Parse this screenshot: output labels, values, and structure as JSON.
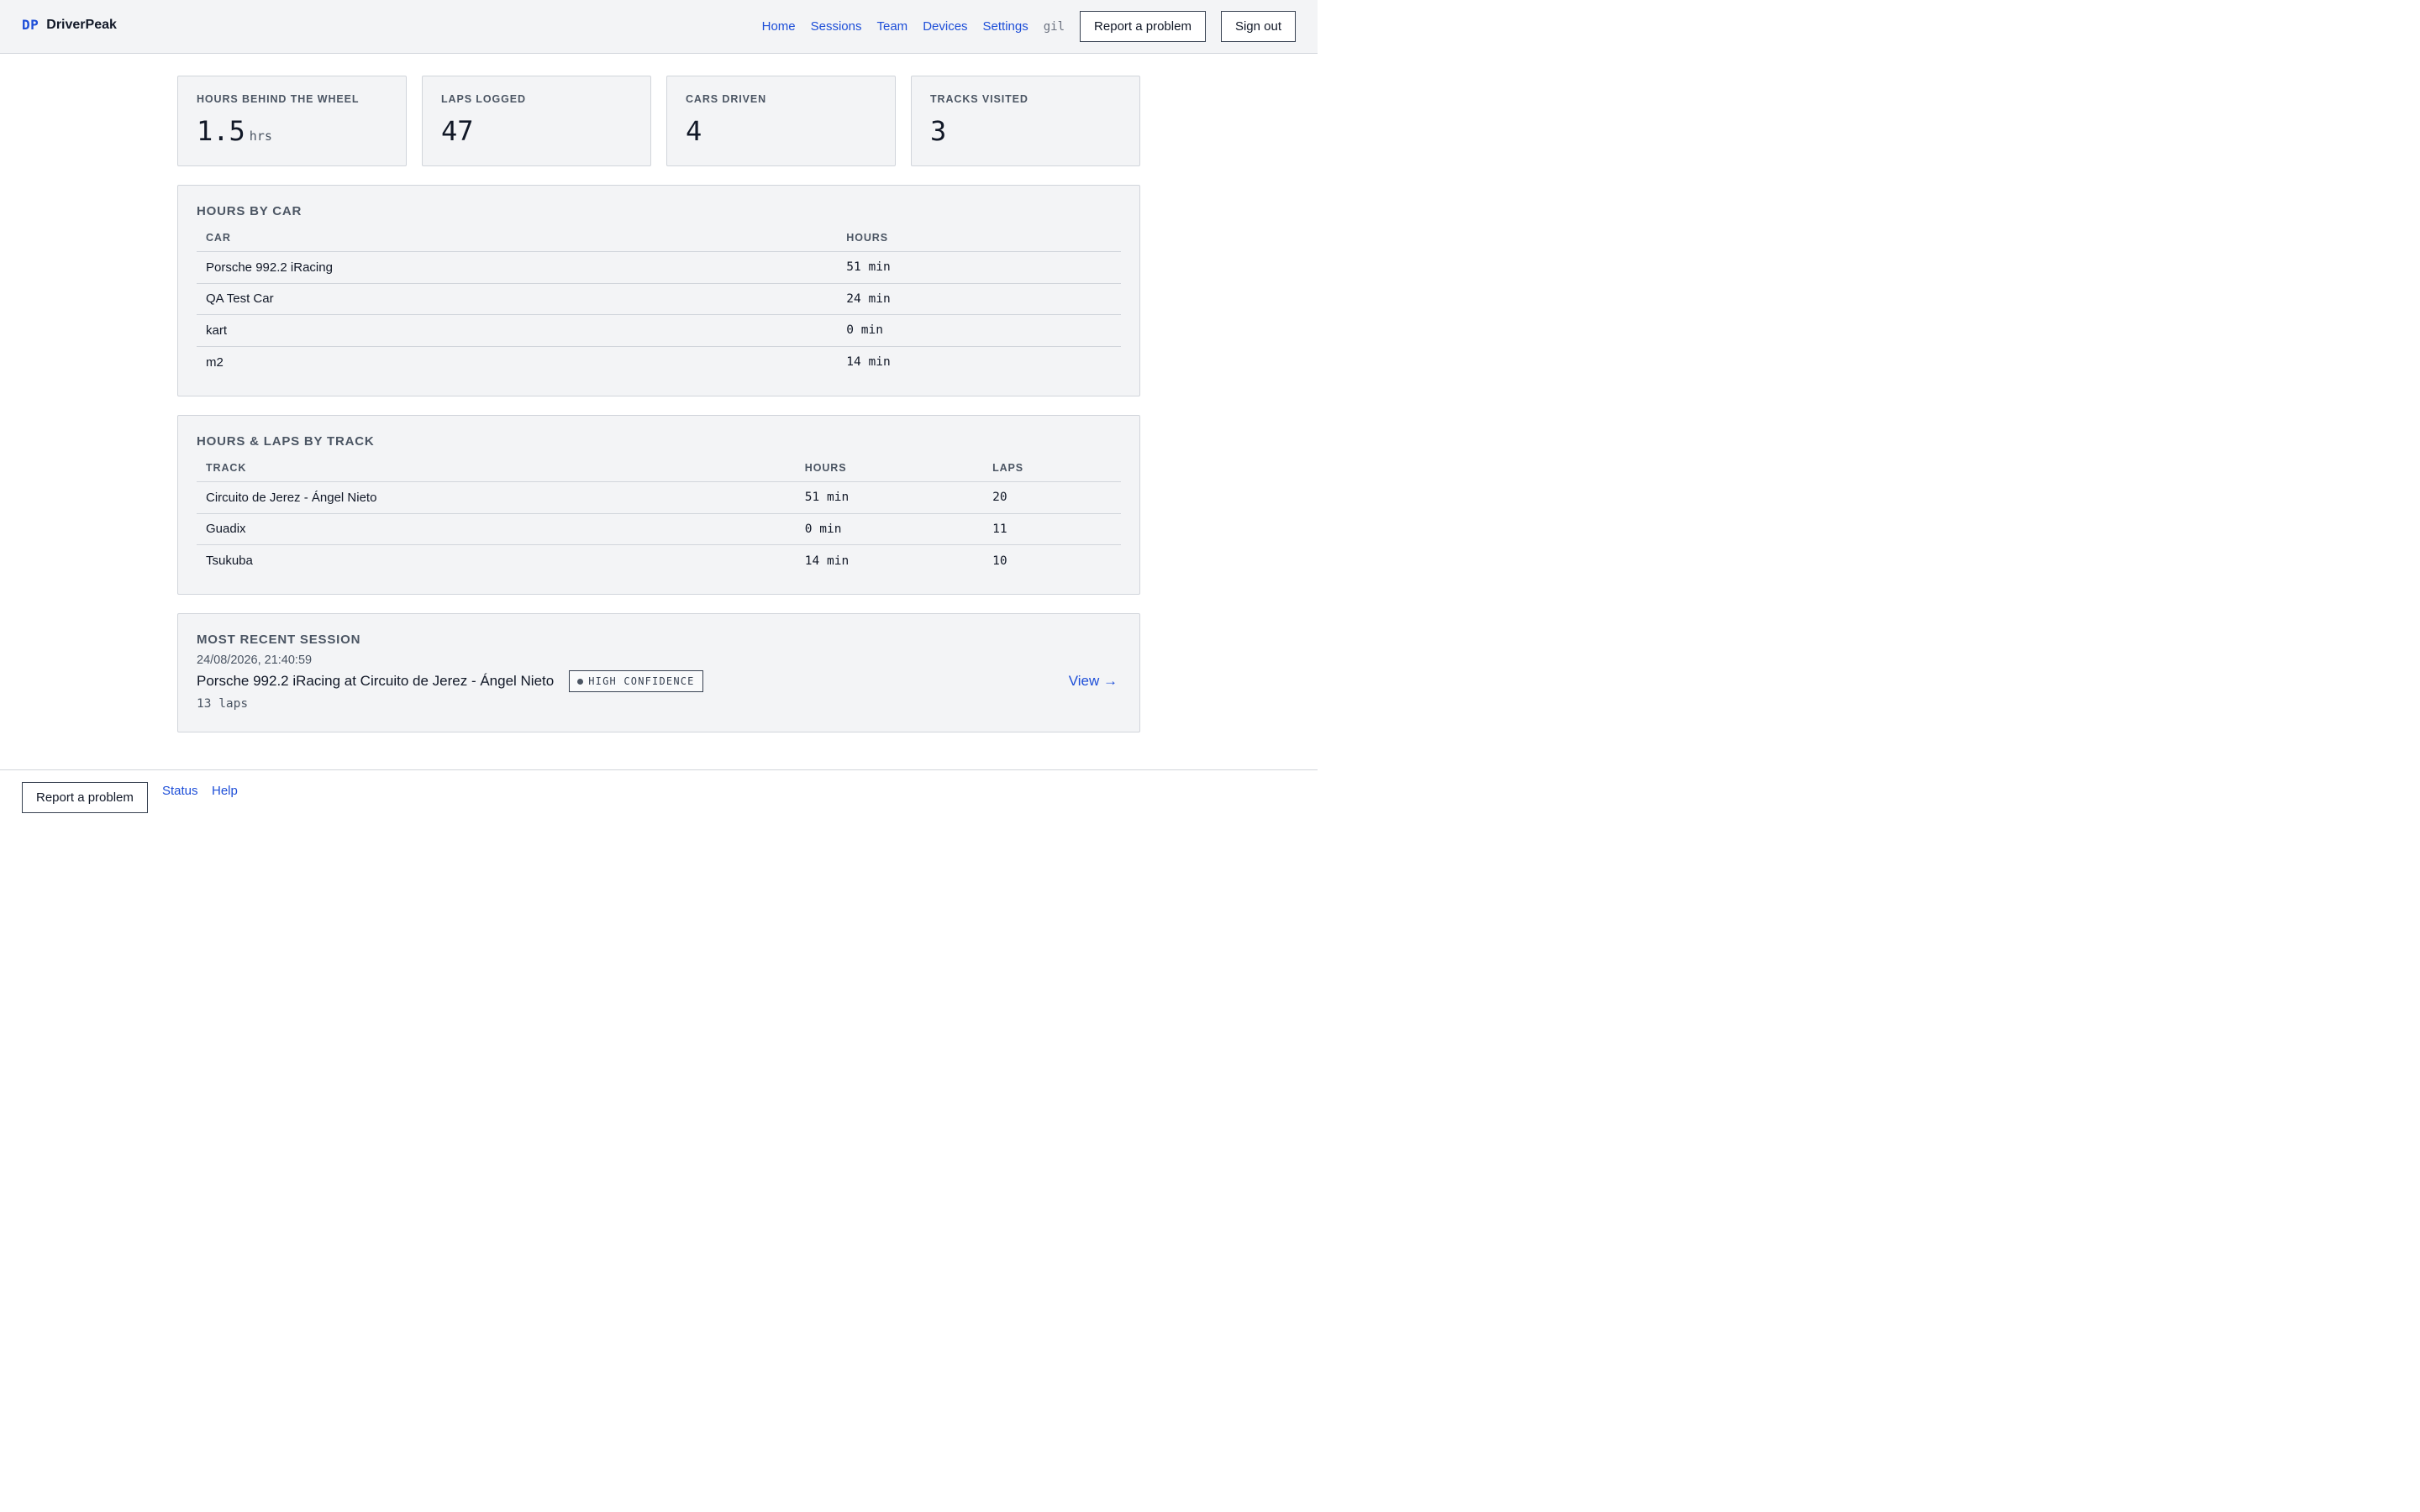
{
  "header": {
    "logo": "DP",
    "brand": "DriverPeak",
    "nav": [
      "Home",
      "Sessions",
      "Team",
      "Devices",
      "Settings"
    ],
    "username": "gil",
    "report_label": "Report a problem",
    "signout_label": "Sign out"
  },
  "stats": [
    {
      "label": "HOURS BEHIND THE WHEEL",
      "value": "1.5",
      "unit": "hrs"
    },
    {
      "label": "LAPS LOGGED",
      "value": "47",
      "unit": ""
    },
    {
      "label": "CARS DRIVEN",
      "value": "4",
      "unit": ""
    },
    {
      "label": "TRACKS VISITED",
      "value": "3",
      "unit": ""
    }
  ],
  "hours_by_car": {
    "title": "HOURS BY CAR",
    "columns": [
      "CAR",
      "HOURS"
    ],
    "rows": [
      {
        "car": "Porsche 992.2 iRacing",
        "hours": "51 min"
      },
      {
        "car": "QA Test Car",
        "hours": "24 min"
      },
      {
        "car": "kart",
        "hours": "0 min"
      },
      {
        "car": "m2",
        "hours": "14 min"
      }
    ]
  },
  "hours_by_track": {
    "title": "HOURS & LAPS BY TRACK",
    "columns": [
      "TRACK",
      "HOURS",
      "LAPS"
    ],
    "rows": [
      {
        "track": "Circuito de Jerez - Ángel Nieto",
        "hours": "51 min",
        "laps": "20"
      },
      {
        "track": "Guadix",
        "hours": "0 min",
        "laps": "11"
      },
      {
        "track": "Tsukuba",
        "hours": "14 min",
        "laps": "10"
      }
    ]
  },
  "recent": {
    "title": "MOST RECENT SESSION",
    "date": "24/08/2026, 21:40:59",
    "session": "Porsche 992.2 iRacing at Circuito de Jerez - Ángel Nieto",
    "badge": "HIGH CONFIDENCE",
    "laps": "13 laps",
    "view_label": "View →"
  },
  "footer": {
    "report_label": "Report a problem",
    "links": [
      "Status",
      "Help"
    ]
  }
}
